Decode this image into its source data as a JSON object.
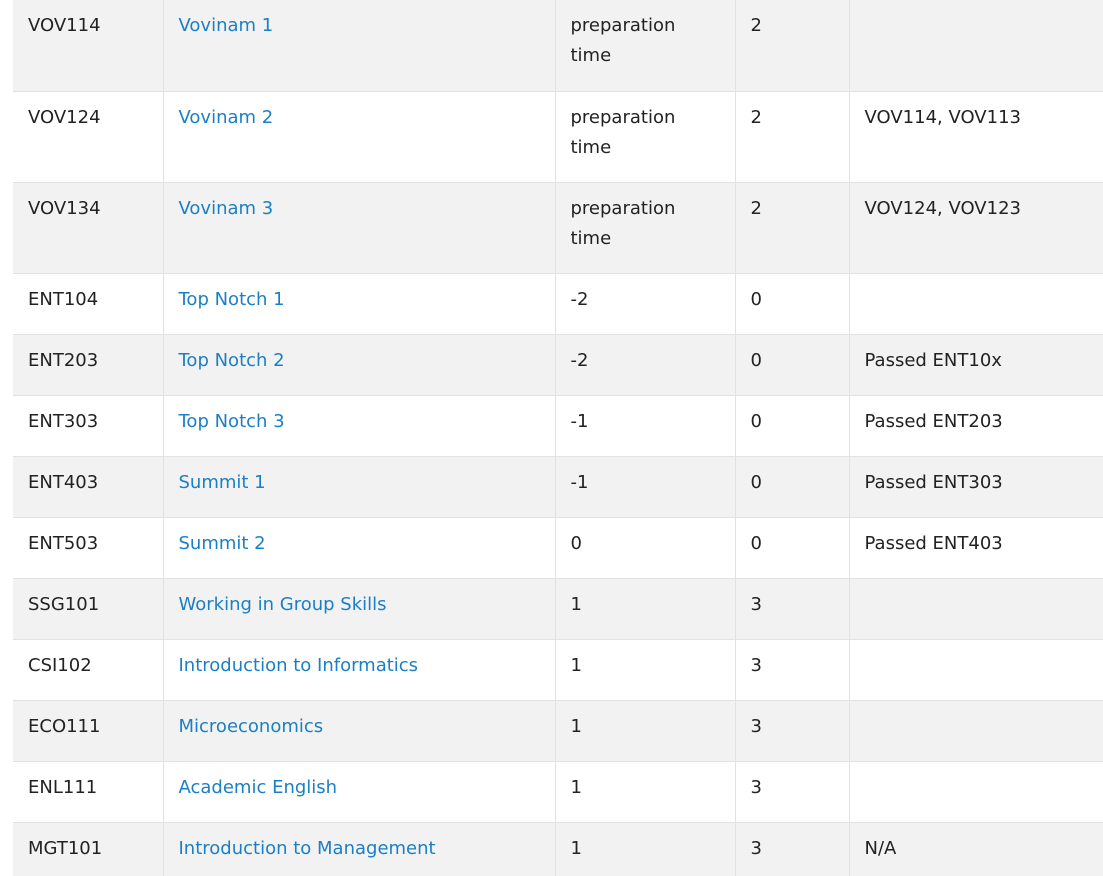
{
  "rows": [
    {
      "code": "VOV114",
      "name": "Vovinam 1",
      "col3": "preparation time",
      "col4": "2",
      "col5": ""
    },
    {
      "code": "VOV124",
      "name": "Vovinam 2",
      "col3": "preparation time",
      "col4": "2",
      "col5": "VOV114, VOV113"
    },
    {
      "code": "VOV134",
      "name": "Vovinam 3",
      "col3": "preparation time",
      "col4": "2",
      "col5": "VOV124, VOV123"
    },
    {
      "code": "ENT104",
      "name": "Top Notch 1",
      "col3": "-2",
      "col4": "0",
      "col5": ""
    },
    {
      "code": "ENT203",
      "name": "Top Notch 2",
      "col3": "-2",
      "col4": "0",
      "col5": "Passed ENT10x"
    },
    {
      "code": "ENT303",
      "name": "Top Notch 3",
      "col3": "-1",
      "col4": "0",
      "col5": "Passed ENT203"
    },
    {
      "code": "ENT403",
      "name": "Summit 1",
      "col3": "-1",
      "col4": "0",
      "col5": "Passed ENT303"
    },
    {
      "code": "ENT503",
      "name": "Summit 2",
      "col3": "0",
      "col4": "0",
      "col5": "Passed ENT403"
    },
    {
      "code": "SSG101",
      "name": "Working in Group Skills",
      "col3": "1",
      "col4": "3",
      "col5": ""
    },
    {
      "code": "CSI102",
      "name": "Introduction to Informatics",
      "col3": "1",
      "col4": "3",
      "col5": ""
    },
    {
      "code": "ECO111",
      "name": "Microeconomics",
      "col3": "1",
      "col4": "3",
      "col5": ""
    },
    {
      "code": "ENL111",
      "name": "Academic English",
      "col3": "1",
      "col4": "3",
      "col5": ""
    },
    {
      "code": "MGT101",
      "name": "Introduction to Management",
      "col3": "1",
      "col4": "3",
      "col5": "N/A"
    }
  ],
  "colors": {
    "link": "#1a7fc4",
    "text": "#222222",
    "row_alt": "#f2f2f2",
    "border": "#e2e2e2"
  }
}
